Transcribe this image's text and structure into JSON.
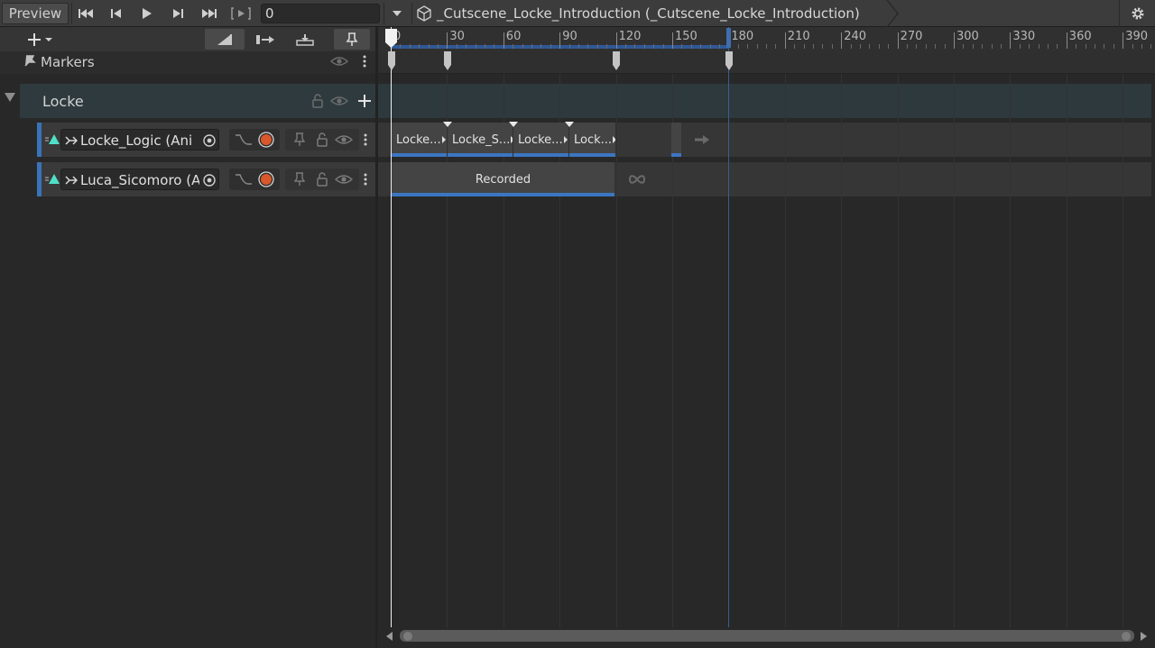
{
  "toolbar": {
    "preview_label": "Preview",
    "first_frame_icon": "⏮",
    "prev_frame_icon": "⏴",
    "play_icon": "▶",
    "next_frame_icon": "⏵",
    "last_frame_icon": "⏭",
    "loop_icon": "[▸]",
    "time_value": "0",
    "asset_title": "_Cutscene_Locke_Introduction (_Cutscene_Locke_Introduction)"
  },
  "ruler": {
    "ticks": [
      "0",
      "30",
      "60",
      "90",
      "120",
      "150",
      "180",
      "210",
      "240",
      "270",
      "300",
      "330",
      "360",
      "390"
    ]
  },
  "markers": {
    "label": "Markers"
  },
  "group": {
    "name": "Locke"
  },
  "tracks": [
    {
      "name": "Locke_Logic (Ani",
      "clips": [
        "Locke...",
        "Locke_S...",
        "Locke...",
        "Lock..."
      ]
    },
    {
      "name": "Luca_Sicomoro (A",
      "clips": [
        "Recorded"
      ]
    }
  ],
  "colors": {
    "accent_blue": "#3b76c2",
    "record_red": "#d9572a",
    "track_icon_teal": "#4fe0c8"
  }
}
